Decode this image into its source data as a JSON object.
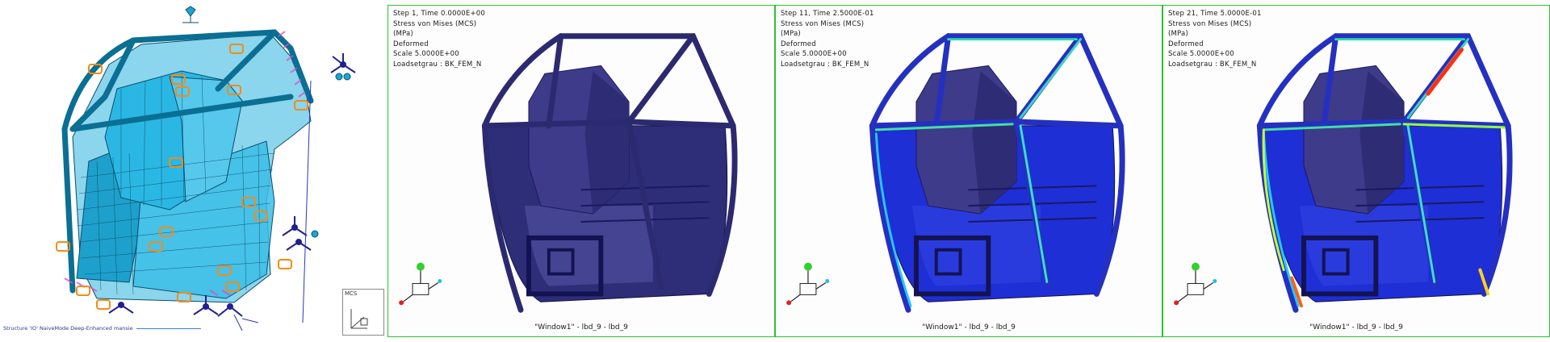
{
  "fem_view": {
    "status_text": "Structure 'IO' NaiveMode Deep-Enhanced mansie",
    "triad_label": "MCS"
  },
  "result_windows": [
    {
      "step_line": "Step 1, Time 0.0000E+00",
      "stress_line": "Stress von Mises (MCS)",
      "units_line": "(MPa)",
      "deformed_line": "Deformed",
      "scale_line": "Scale 5.0000E+00",
      "loadset_line": "Loadsetgrau : BK_FEM_N",
      "window_label": "\"Window1\" - lbd_9 - lbd_9",
      "stress_level": 0
    },
    {
      "step_line": "Step 11, Time 2.5000E-01",
      "stress_line": "Stress von Mises (MCS)",
      "units_line": "(MPa)",
      "deformed_line": "Deformed",
      "scale_line": "Scale 5.0000E+00",
      "loadset_line": "Loadsetgrau : BK_FEM_N",
      "window_label": "\"Window1\" - lbd_9 - lbd_9",
      "stress_level": 1
    },
    {
      "step_line": "Step 21, Time 5.0000E-01",
      "stress_line": "Stress von Mises (MCS)",
      "units_line": "(MPa)",
      "deformed_line": "Deformed",
      "scale_line": "Scale 5.0000E+00",
      "loadset_line": "Loadsetgrau : BK_FEM_N",
      "window_label": "\"Window1\" - lbd_9 - lbd_9",
      "stress_level": 2
    }
  ],
  "colors": {
    "frame_border": "#2fbf2f",
    "mesh_cyan": "#1aa6d4",
    "model_navy": "#2e2d78",
    "stress_blue": "#1f2fd6",
    "constraint_orange": "#f28c18",
    "constraint_navy": "#202090",
    "load_magenta": "#e040c0"
  }
}
